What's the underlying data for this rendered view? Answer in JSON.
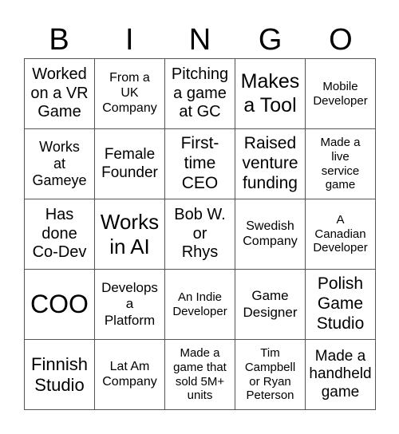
{
  "header": [
    "B",
    "I",
    "N",
    "G",
    "O"
  ],
  "cells": [
    "Worked\non a VR\nGame",
    "From a\nUK\nCompany",
    "Pitching\na game\nat GC",
    "Makes\na Tool",
    "Mobile\nDeveloper",
    "Works\nat\nGameye",
    "Female\nFounder",
    "First-\ntime\nCEO",
    "Raised\nventure\nfunding",
    "Made a\nlive\nservice\ngame",
    "Has\ndone\nCo-Dev",
    "Works\nin AI",
    "Bob W.\nor\nRhys",
    "Swedish\nCompany",
    "A\nCanadian\nDeveloper",
    "COO",
    "Develops\na\nPlatform",
    "An Indie\nDeveloper",
    "Game\nDesigner",
    "Polish\nGame\nStudio",
    "Finnish\nStudio",
    "Lat Am\nCompany",
    "Made a\ngame that\nsold 5M+\nunits",
    "Tim\nCampbell\nor Ryan\nPeterson",
    "Made a\nhandheld\ngame"
  ]
}
